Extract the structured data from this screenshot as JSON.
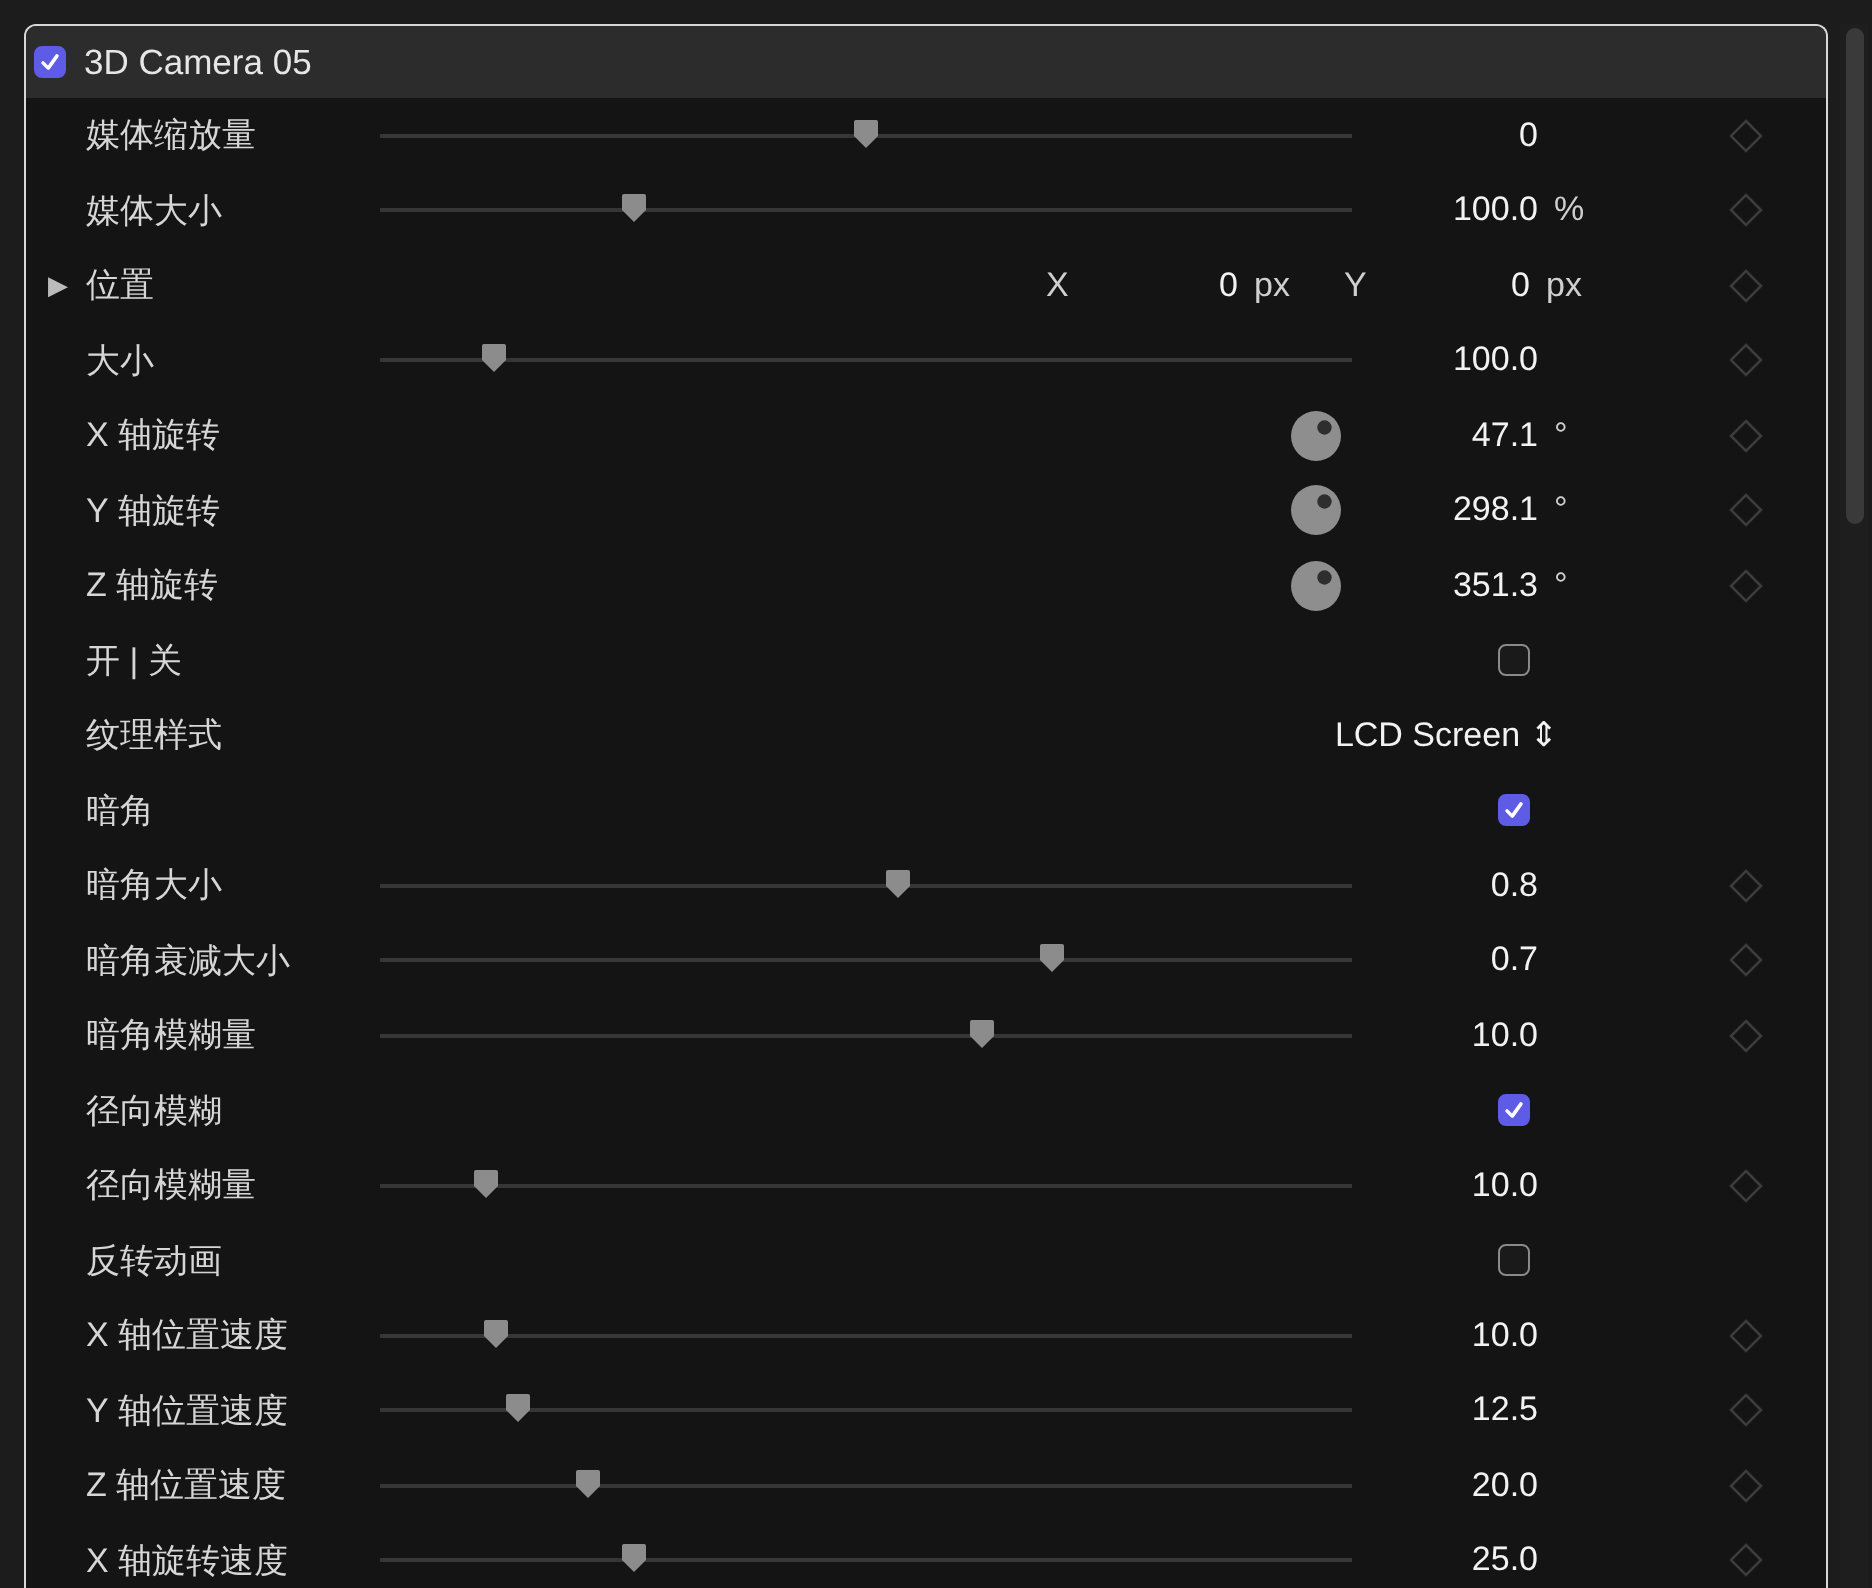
{
  "effect": {
    "title": "3D Camera 05",
    "enabled": true
  },
  "params": [
    {
      "kind": "slider",
      "label": "媒体缩放量",
      "level": 0.5,
      "value": "0"
    },
    {
      "kind": "slider",
      "label": "媒体大小",
      "level": 0.254,
      "value": "100.0",
      "unit": "%"
    },
    {
      "kind": "point",
      "label": "位置",
      "toggle": "▶",
      "expanded": false,
      "x_label": "X",
      "x_value": "0",
      "x_unit": "px",
      "y_label": "Y",
      "y_value": "0",
      "y_unit": "px"
    },
    {
      "kind": "slider",
      "label": "大小",
      "level": 0.106,
      "value": "100.0"
    },
    {
      "kind": "dial",
      "label": "X 轴旋转",
      "value": "47.1",
      "unit": "°"
    },
    {
      "kind": "dial",
      "label": "Y 轴旋转",
      "value": "298.1",
      "unit": "°"
    },
    {
      "kind": "dial",
      "label": "Z 轴旋转",
      "value": "351.3",
      "unit": "°"
    },
    {
      "kind": "checkbox",
      "label": "开 | 关",
      "checked": false
    },
    {
      "kind": "popup",
      "label": "纹理样式",
      "value": "LCD Screen",
      "arrows": "⇕"
    },
    {
      "kind": "checkbox",
      "label": "暗角",
      "checked": true
    },
    {
      "kind": "slider",
      "label": "暗角大小",
      "level": 0.534,
      "value": "0.8"
    },
    {
      "kind": "slider",
      "label": "暗角衰减大小",
      "level": 0.697,
      "value": "0.7"
    },
    {
      "kind": "slider",
      "label": "暗角模糊量",
      "level": 0.623,
      "value": "10.0"
    },
    {
      "kind": "checkbox",
      "label": "径向模糊",
      "checked": true
    },
    {
      "kind": "slider",
      "label": "径向模糊量",
      "level": 0.097,
      "value": "10.0"
    },
    {
      "kind": "checkbox",
      "label": "反转动画",
      "checked": false
    },
    {
      "kind": "slider",
      "label": "X 轴位置速度",
      "level": 0.108,
      "value": "10.0"
    },
    {
      "kind": "slider",
      "label": "Y 轴位置速度",
      "level": 0.131,
      "value": "12.5"
    },
    {
      "kind": "slider",
      "label": "Z 轴位置速度",
      "level": 0.205,
      "value": "20.0"
    },
    {
      "kind": "slider",
      "label": "X 轴旋转速度",
      "level": 0.254,
      "value": "25.0"
    }
  ]
}
